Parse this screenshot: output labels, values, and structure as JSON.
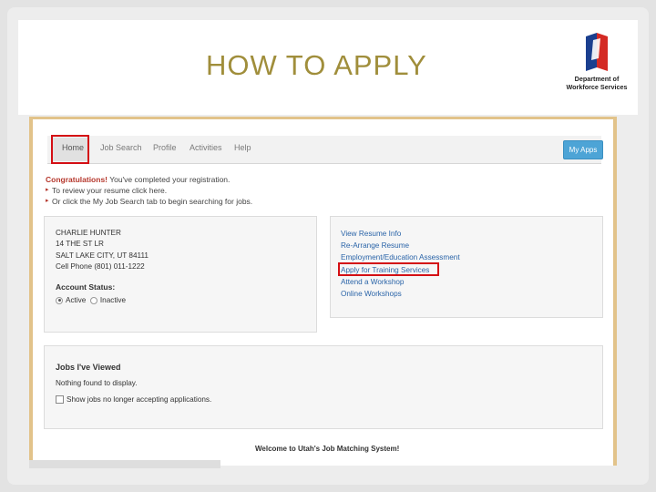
{
  "slide": {
    "title": "HOW TO APPLY",
    "logo": {
      "line1": "Department of",
      "line2": "Workforce Services",
      "icon": "dws-flag-logo"
    }
  },
  "nav": {
    "home": "Home",
    "job_search": "Job Search",
    "profile": "Profile",
    "activities": "Activities",
    "help": "Help",
    "my_apps": "My Apps"
  },
  "notice": {
    "congrats": "Congratulations!",
    "congrats_rest": " You've completed your registration.",
    "item1": "To review your resume click here.",
    "item2": "Or click the My Job Search tab to begin searching for jobs."
  },
  "profile_panel": {
    "name": "CHARLIE  HUNTER",
    "address1": "14 THE ST LR",
    "address2": "SALT LAKE CITY, UT  84111",
    "phone": "Cell Phone (801) 011-1222",
    "status_label": "Account Status:",
    "status_options": [
      "Active",
      "Inactive"
    ],
    "status_selected": "Active"
  },
  "links_panel": {
    "links": [
      "View Resume Info",
      "Re-Arrange Resume",
      "Employment/Education Assessment",
      "Apply for Training Services",
      "Attend a Workshop",
      "Online Workshops"
    ],
    "highlighted": "Apply for Training Services"
  },
  "jobs_panel": {
    "title": "Jobs I've Viewed",
    "empty_text": "Nothing found to display.",
    "checkbox_label": "Show jobs no longer accepting applications."
  },
  "footer": {
    "welcome": "Welcome to Utah's Job Matching System!"
  },
  "colors": {
    "title": "#a08e3b",
    "highlight_box": "#d40f14",
    "my_apps_button": "#4da4d6",
    "link": "#2a64a8",
    "frame_border": "#e2c38a"
  }
}
